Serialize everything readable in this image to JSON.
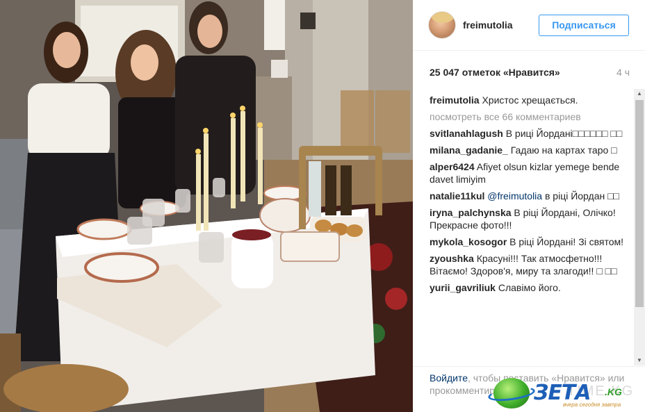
{
  "post": {
    "photo_alt": "",
    "username": "freimutolia",
    "follow_label": "Подписаться",
    "likes": "25 047 отметок «Нравится»",
    "time": "4 ч"
  },
  "caption": {
    "user": "freimutolia",
    "text": "Христос хрещається."
  },
  "view_all": "посмотреть все 66 комментариев",
  "comments": [
    {
      "user": "svitlanahlagush",
      "text": "В риці Йордані□□□□□□ □□"
    },
    {
      "user": "milana_gadanie_",
      "text": "Гадаю на картах таро □"
    },
    {
      "user": "alper6424",
      "text": "Afiyet olsun kizlar yemege bende davet limiyim"
    },
    {
      "user": "natalie11kul",
      "mention": "@freimutolia",
      "text": "в ріці Йордан □□"
    },
    {
      "user": "iryna_palchynska",
      "text": "В ріці Йордані, Олічко! Прекрасне фото!!!"
    },
    {
      "user": "mykola_kosogor",
      "text": "В ріці Йордані! Зі святом!"
    },
    {
      "user": "zyoushka",
      "text": "Красуні!!! Так атмосфетно!!! Вітаємо! Здоров'я, миру та злагоди!! □ □□"
    },
    {
      "user": "yurii_gavriliuk",
      "text": "Славімо його."
    }
  ],
  "footer": {
    "login": "Войдите",
    "text": ", чтобы поставить «Нравится» или прокомментировать."
  },
  "watermark": {
    "name": "ЗЕТА",
    "domain": ".KG",
    "slogan": "вчера сегодня завтра",
    "ghost": "TIME.KG"
  },
  "colors": {
    "accent": "#3897f0",
    "link": "#003569",
    "muted": "#999999"
  }
}
